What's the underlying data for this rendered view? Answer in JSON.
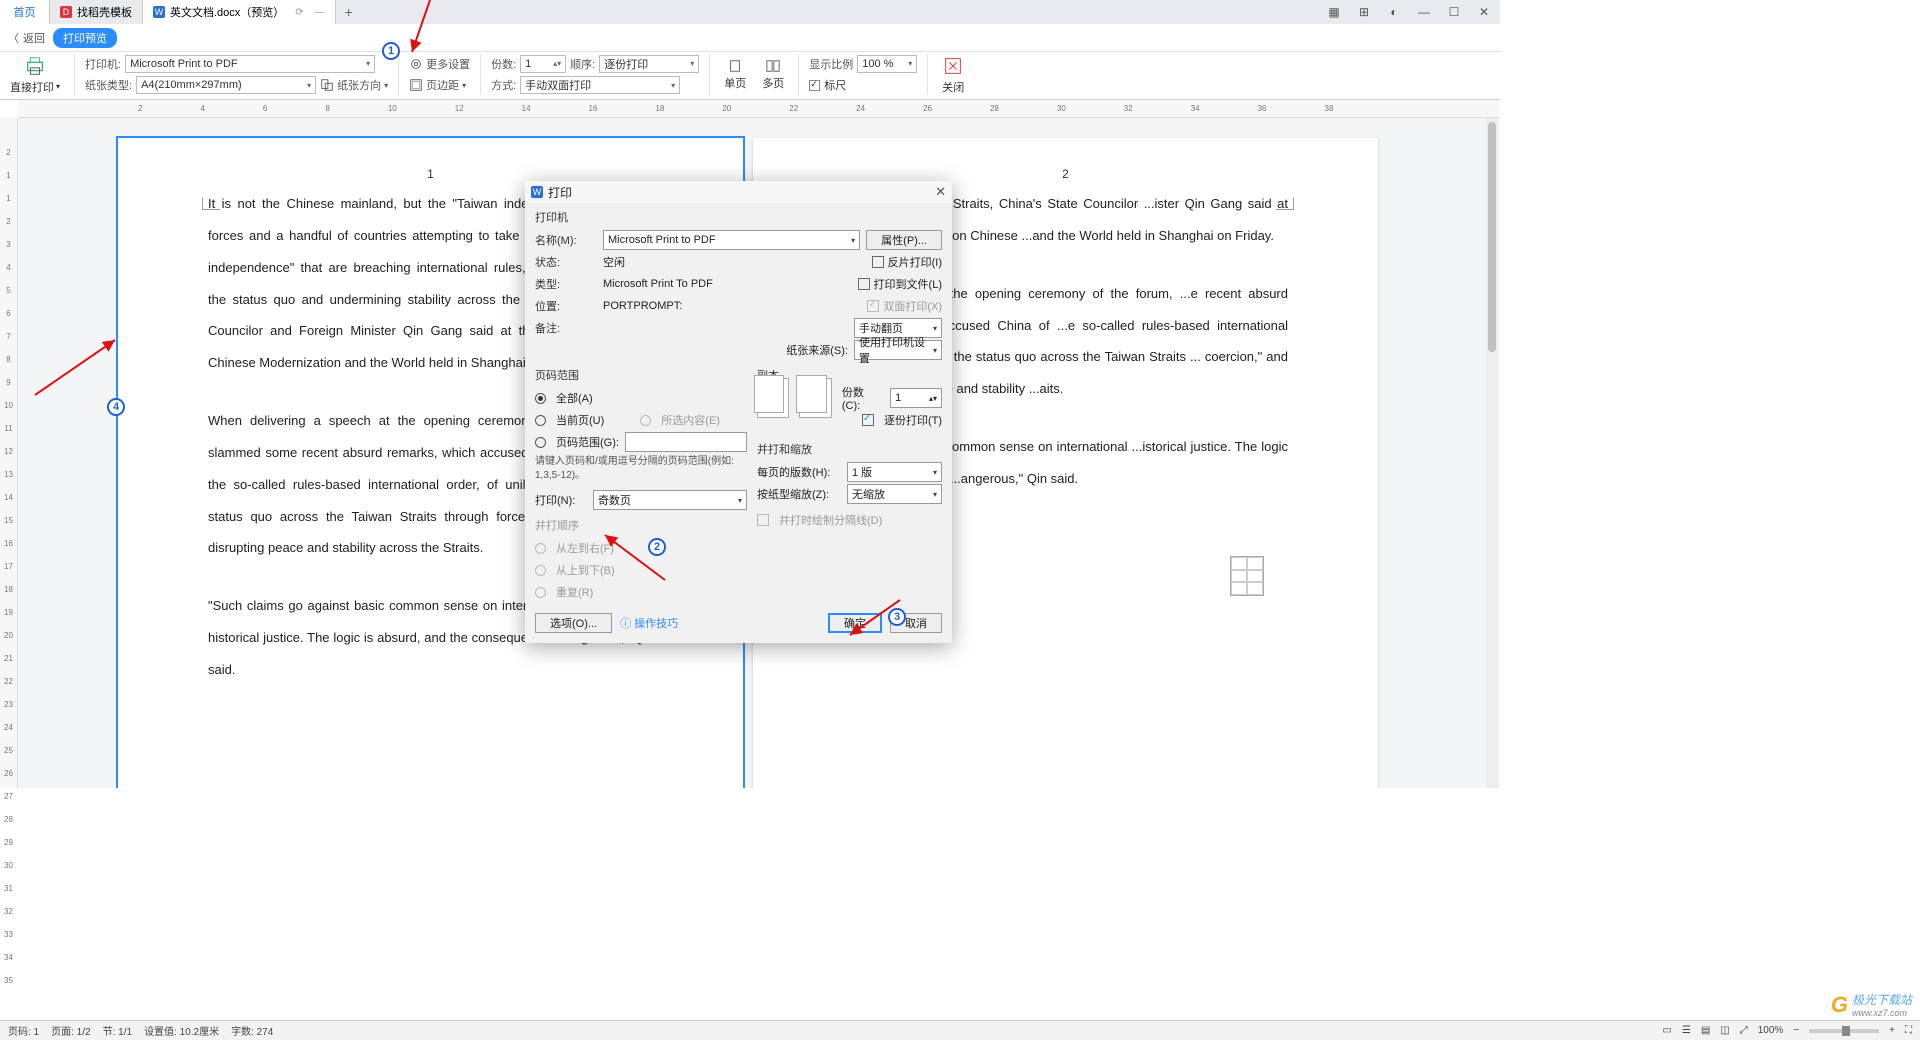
{
  "tabs": {
    "home": "首页",
    "t1": "找稻壳模板",
    "t2": "英文文档.docx（预览）",
    "add": "+"
  },
  "win": {
    "grid": "▦",
    "apps": "⊞",
    "avatar": "◐",
    "min": "—",
    "max": "☐",
    "close": "✕"
  },
  "rb1": {
    "back": "返回",
    "badge": "打印预览"
  },
  "toolbar": {
    "direct_print": "直接打印",
    "direct_caret": "▾",
    "printer_label": "打印机:",
    "printer_value": "Microsoft Print to PDF",
    "paper_label": "纸张类型:",
    "paper_value": "A4(210mm×297mm)",
    "more_settings": "更多设置",
    "copies_label": "份数:",
    "copies_value": "1",
    "order_label": "顺序:",
    "order_value": "逐份打印",
    "paper_dir": "纸张方向",
    "margin": "页边距",
    "mode_label": "方式:",
    "mode_value": "手动双面打印",
    "single_page": "单页",
    "multi_page": "多页",
    "ratio_label": "显示比例",
    "ratio_value": "100 %",
    "ruler_chk": "标尺",
    "close": "关闭"
  },
  "ruler_h": [
    "2",
    "4",
    "6",
    "8",
    "10",
    "12",
    "14",
    "16",
    "18",
    "20",
    "22",
    "24",
    "26",
    "28",
    "30",
    "32",
    "34",
    "36",
    "38"
  ],
  "ruler_v": [
    "2",
    "1",
    "1",
    "2",
    "3",
    "4",
    "5",
    "6",
    "7",
    "8",
    "9",
    "10",
    "11",
    "12",
    "13",
    "14",
    "15",
    "16",
    "17",
    "18",
    "19",
    "20",
    "21",
    "22",
    "23",
    "24",
    "25",
    "26",
    "27",
    "28",
    "29",
    "30",
    "31",
    "32",
    "33",
    "34",
    "35"
  ],
  "page1": {
    "num": "1",
    "p1": "It is not the Chinese mainland, but the \"Taiwan independence\" separatist forces and a handful of countries attempting to take advantage of \"Taiwan independence\" that are breaching international rules, unilaterally changing the status quo and undermining stability across the Straits, China's State Councilor and Foreign Minister Qin Gang said at the Lanting Forum on Chinese Modernization and the World held in Shanghai on Friday.",
    "p2": "When delivering a speech at the opening ceremony of the forum, Qin slammed some recent absurd remarks, which accused China of challenging the so-called rules-based international order, of unilaterally changing the status quo across the Taiwan Straits through force or coercion, and of disrupting peace and stability across the Straits.",
    "p3": "\"Such claims go against basic common sense on international relations and historical justice. The logic is absurd, and the consequences dangerous,\" Qin said."
  },
  "page2": {
    "num": "2",
    "p1": "...bility across the Straits, China's State Councilor ...ister Qin Gang said at the Lanting Forum on Chinese ...and the World held in Shanghai on Friday.",
    "p2": "...g a speech at the opening ceremony of the forum, ...e recent absurd remarks, which accused China of ...e so-called rules-based international order,\" of ...anging the status quo across the Taiwan Straits ... coercion,\" and of disrupting peace and stability ...aits.",
    "p3": "...o against basic common sense on international ...istorical justice. The logic is absurd, and the ...angerous,\" Qin said."
  },
  "dialog": {
    "title": "打印",
    "printer_section": "打印机",
    "name_label": "名称(M):",
    "name_value": "Microsoft Print to PDF",
    "props_btn": "属性(P)...",
    "status_label": "状态:",
    "status_value": "空闲",
    "type_label": "类型:",
    "type_value": "Microsoft Print To PDF",
    "where_label": "位置:",
    "where_value": "PORTPROMPT:",
    "comment_label": "备注:",
    "reverse_print": "反片打印(I)",
    "print_to_file": "打印到文件(L)",
    "duplex": "双面打印(X)",
    "duplex_mode": "手动翻页",
    "paper_src_label": "纸张来源(S):",
    "paper_src_value": "使用打印机设置",
    "range_section": "页码范围",
    "range_all": "全部(A)",
    "range_current": "当前页(U)",
    "range_sel": "所选内容(E)",
    "range_pages": "页码范围(G):",
    "range_hint": "请键入页码和/或用逗号分隔的页码范围(例如: 1,3,5-12)。",
    "print_n_label": "打印(N):",
    "print_n_value": "奇数页",
    "collate_section": "并打顺序",
    "lr": "从左到右(F)",
    "tb": "从上到下(B)",
    "repeat": "重复(R)",
    "copies_section": "副本",
    "copies_label": "份数(C):",
    "copies_value": "1",
    "collate_chk": "逐份打印(T)",
    "scale_section": "并打和缩放",
    "pps_label": "每页的版数(H):",
    "pps_value": "1 版",
    "fit_label": "按纸型缩放(Z):",
    "fit_value": "无缩放",
    "draw_border": "并打时绘制分隔线(D)",
    "options_btn": "选项(O)...",
    "tips": "操作技巧",
    "ok": "确定",
    "cancel": "取消"
  },
  "status": {
    "page_no": "页码: 1",
    "pages": "页面: 1/2",
    "sections": "节: 1/1",
    "set_val": "设置值: 10.2厘米",
    "words": "字数: 274",
    "zoom": "100%"
  },
  "callouts": {
    "c1": "1",
    "c2": "2",
    "c3": "3",
    "c4": "4"
  },
  "watermark": {
    "brand": "极光下载站",
    "url": "www.xz7.com"
  }
}
